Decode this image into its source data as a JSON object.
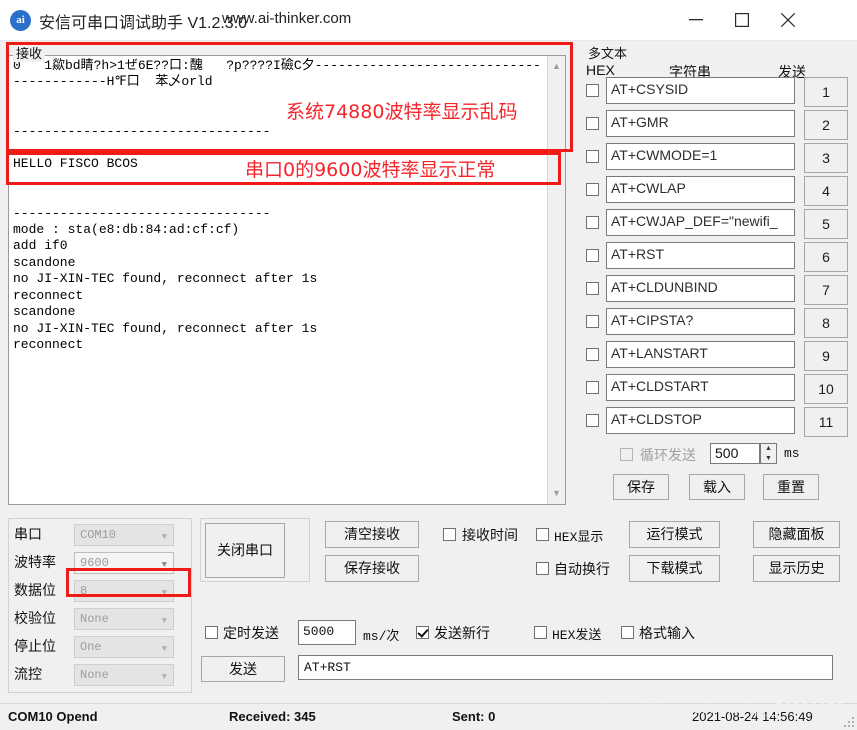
{
  "window": {
    "logo_text": "ai",
    "title": "安信可串口调试助手 V1.2.3.0",
    "url": "www.ai-thinker.com",
    "minimize": "minimize-icon",
    "maximize": "maximize-icon",
    "close": "close-icon"
  },
  "receive": {
    "label": "接收",
    "lines": "0   1歘bd睛?h>1ぜ6E??口:醜   ?p????I礆C夕------------------------------------\n------------H℉口  苯乄orld\n\n\n---------------------------------\n\nHELLO FISCO BCOS\n\n\n---------------------------------\nmode : sta(e8:db:84:ad:cf:cf)\nadd if0\nscandone\nno JI-XIN-TEC found, reconnect after 1s\nreconnect\nscandone\nno JI-XIN-TEC found, reconnect after 1s\nreconnect",
    "scroll_up": "scroll-up-arrow",
    "scroll_down": "scroll-down-arrow"
  },
  "annotations": [
    {
      "text": "系统74880波特率显示乱码"
    },
    {
      "text": "串口0的9600波特率显示正常"
    }
  ],
  "multitext": {
    "label": "多文本",
    "col_hex": "HEX",
    "col_string": "字符串",
    "col_send": "发送",
    "rows": [
      {
        "cmd": "AT+CSYSID",
        "num": "1"
      },
      {
        "cmd": "AT+GMR",
        "num": "2"
      },
      {
        "cmd": "AT+CWMODE=1",
        "num": "3"
      },
      {
        "cmd": "AT+CWLAP",
        "num": "4"
      },
      {
        "cmd": "AT+CWJAP_DEF=\"newifi_",
        "num": "5"
      },
      {
        "cmd": "AT+RST",
        "num": "6"
      },
      {
        "cmd": "AT+CLDUNBIND",
        "num": "7"
      },
      {
        "cmd": "AT+CIPSTA?",
        "num": "8"
      },
      {
        "cmd": "AT+LANSTART",
        "num": "9"
      },
      {
        "cmd": "AT+CLDSTART",
        "num": "10"
      },
      {
        "cmd": "AT+CLDSTOP",
        "num": "11"
      }
    ],
    "loop_label": "循环发送",
    "loop_value": "500",
    "loop_unit": "ms",
    "save": "保存",
    "load": "载入",
    "reset": "重置"
  },
  "serial": {
    "rows": [
      {
        "label": "串口",
        "value": "COM10",
        "active": false
      },
      {
        "label": "波特率",
        "value": "9600",
        "active": true
      },
      {
        "label": "数据位",
        "value": "8",
        "active": false
      },
      {
        "label": "校验位",
        "value": "None",
        "active": false
      },
      {
        "label": "停止位",
        "value": "One",
        "active": false
      },
      {
        "label": "流控",
        "value": "None",
        "active": false
      }
    ],
    "close_port": "关闭串口"
  },
  "controls": {
    "clear_recv": "清空接收",
    "save_recv": "保存接收",
    "recv_time": "接收时间",
    "hex_display": "HEX显示",
    "auto_wrap": "自动换行",
    "run_mode": "运行模式",
    "download_mode": "下载模式",
    "hide_panel": "隐藏面板",
    "show_history": "显示历史"
  },
  "sendbar": {
    "timed_send": "定时发送",
    "interval": "5000",
    "interval_unit": "ms/次",
    "send_newline": "发送新行",
    "hex_send": "HEX发送",
    "format_input": "格式输入",
    "send_button": "发送",
    "send_text": "AT+RST"
  },
  "status": {
    "port": "COM10 Opend",
    "received": "Received: 345",
    "sent": "Sent: 0",
    "datetime": "2021-08-24 14:56:49",
    "watermark": "https://blog.csdn.net/qq_50880658"
  }
}
